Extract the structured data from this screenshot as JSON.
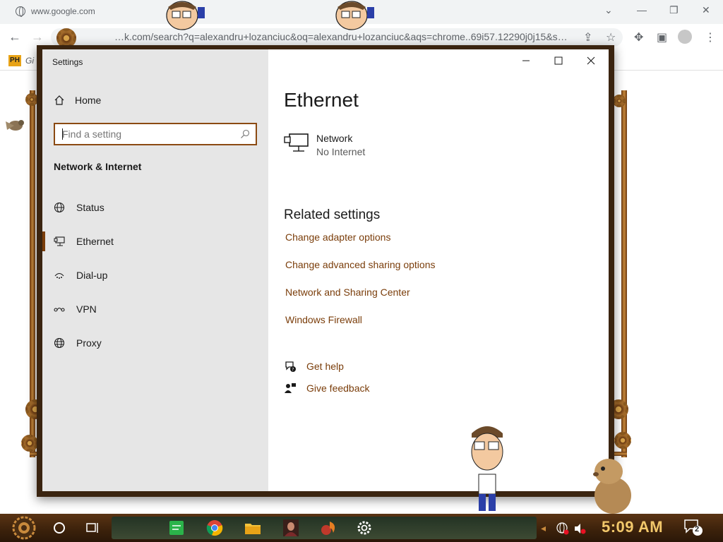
{
  "browser": {
    "tab_url": "www.google.com",
    "address_text": "…k.com/search?q=alexandru+lozanciuc&oq=alexandru+lozanciuc&aqs=chrome..69i57.12290j0j15&s…",
    "bookmark_badge": "PH",
    "bookmark_label": "Gi"
  },
  "settings": {
    "window_title": "Settings",
    "home_label": "Home",
    "search_placeholder": "Find a setting",
    "section_heading": "Network & Internet",
    "nav_items": [
      {
        "label": "Status",
        "icon": "globe-status-icon",
        "active": false
      },
      {
        "label": "Ethernet",
        "icon": "ethernet-icon",
        "active": true
      },
      {
        "label": "Dial-up",
        "icon": "dialup-icon",
        "active": false
      },
      {
        "label": "VPN",
        "icon": "vpn-icon",
        "active": false
      },
      {
        "label": "Proxy",
        "icon": "proxy-globe-icon",
        "active": false
      }
    ],
    "page_title": "Ethernet",
    "network": {
      "name": "Network",
      "status": "No Internet"
    },
    "related_heading": "Related settings",
    "related_links": [
      "Change adapter options",
      "Change advanced sharing options",
      "Network and Sharing Center",
      "Windows Firewall"
    ],
    "help": {
      "get_help": "Get help",
      "give_feedback": "Give feedback"
    }
  },
  "taskbar": {
    "clock": "5:09 AM",
    "notification_count": "2"
  },
  "colors": {
    "accent": "#7a3d0a",
    "search_border": "#8b4a12",
    "clock": "#f2c86b",
    "sidebar_bg": "#e6e6e6"
  }
}
